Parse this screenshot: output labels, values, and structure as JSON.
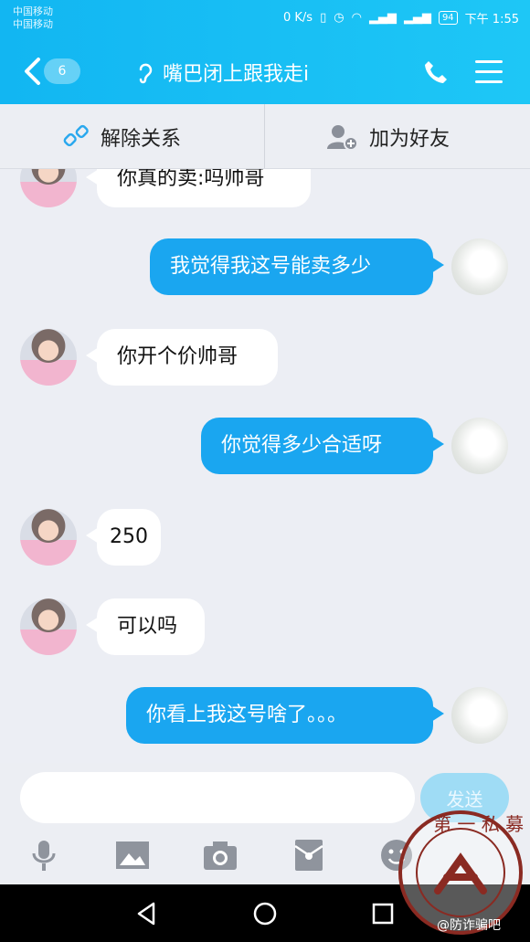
{
  "status_bar": {
    "carrier_1": "中国移动",
    "carrier_2": "中国移动",
    "network_speed": "0 K/s",
    "battery": "94",
    "time": "下午 1:55"
  },
  "header": {
    "back_count": "6",
    "title": "嘴巴闭上跟我走i"
  },
  "actions": {
    "unlink_label": "解除关系",
    "add_friend_label": "加为好友"
  },
  "messages": [
    {
      "side": "in",
      "text": "你真的卖:吗帅哥"
    },
    {
      "side": "out",
      "text": "我觉得我这号能卖多少"
    },
    {
      "side": "in",
      "text": "你开个价帅哥"
    },
    {
      "side": "out",
      "text": "你觉得多少合适呀"
    },
    {
      "side": "in",
      "text": "250"
    },
    {
      "side": "in",
      "text": "可以吗"
    },
    {
      "side": "out",
      "text": "你看上我这号啥了。。。"
    }
  ],
  "composer": {
    "input_value": "",
    "send_label": "发送"
  },
  "watermark": {
    "seal_text": "第一私募",
    "caption": "@防诈骗吧"
  }
}
